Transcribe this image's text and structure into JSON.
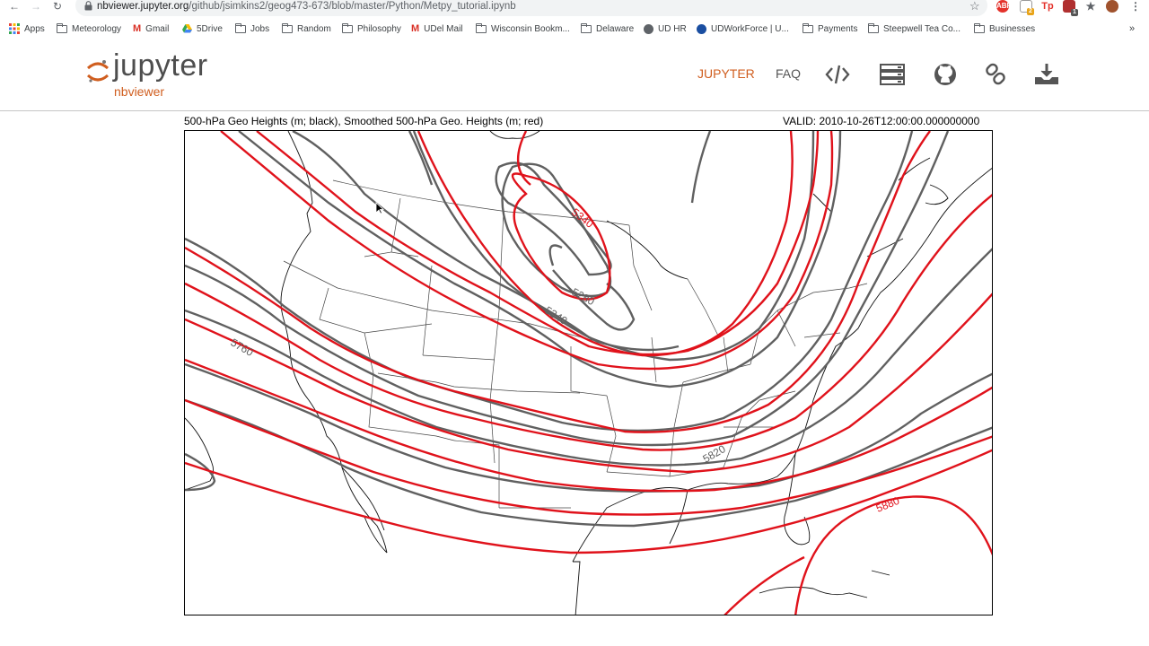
{
  "browser": {
    "url_host": "nbviewer.jupyter.org",
    "url_path": "/github/jsimkins2/geog473-673/blob/master/Python/Metpy_tutorial.ipynb",
    "bookmarks": [
      {
        "label": "Apps",
        "icon": "apps-grid-icon"
      },
      {
        "label": "Meteorology",
        "icon": "folder-icon"
      },
      {
        "label": "Gmail",
        "icon": "gmail-icon"
      },
      {
        "label": "5Drive",
        "icon": "drive-icon"
      },
      {
        "label": "Jobs",
        "icon": "folder-icon"
      },
      {
        "label": "Random",
        "icon": "folder-icon"
      },
      {
        "label": "Philosophy",
        "icon": "folder-icon"
      },
      {
        "label": "UDel Mail",
        "icon": "gmail-icon"
      },
      {
        "label": "Wisconsin Bookm...",
        "icon": "folder-icon"
      },
      {
        "label": "Delaware",
        "icon": "folder-icon"
      },
      {
        "label": "UD HR",
        "icon": "globe-icon"
      },
      {
        "label": "UDWorkForce | U...",
        "icon": "ud-icon"
      },
      {
        "label": "Payments",
        "icon": "folder-icon"
      },
      {
        "label": "Steepwell Tea Co...",
        "icon": "folder-icon"
      },
      {
        "label": "Businesses",
        "icon": "folder-icon"
      }
    ],
    "more_label": "»",
    "extensions": [
      {
        "label": "ABP",
        "color": "#e4322b"
      },
      {
        "label": "2",
        "color": "#e8a317"
      },
      {
        "label": "Tp",
        "color": "#e4322b"
      },
      {
        "label": "1",
        "color": "#c0392b"
      },
      {
        "label": "",
        "color": "#5f6368"
      }
    ]
  },
  "header": {
    "logo_word": "jupyter",
    "logo_sub": "nbviewer",
    "nav": {
      "jupyter": "JUPYTER",
      "faq": "FAQ"
    },
    "icons": [
      "code-icon",
      "server-stack-icon",
      "github-icon",
      "link-icon",
      "download-icon"
    ]
  },
  "plot": {
    "title_left": "500-hPa Geo Heights (m; black), Smoothed 500-hPa Geo. Heights (m; red)",
    "title_right": "VALID: 2010-10-26T12:00:00.000000000",
    "contour_labels": [
      "5340",
      "5280",
      "5340",
      "5760",
      "5820",
      "5880"
    ],
    "colors": {
      "raw": "#606060",
      "smoothed": "#e0121b",
      "coast": "#111111",
      "border": "#444444"
    }
  }
}
